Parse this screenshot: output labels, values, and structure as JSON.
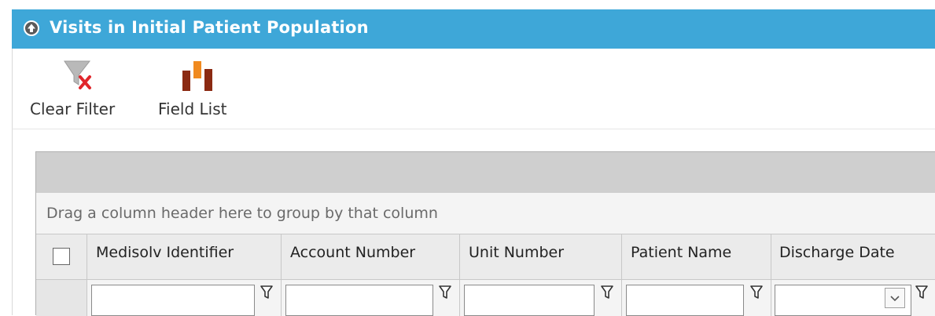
{
  "panel": {
    "title": "Visits in Initial Patient Population",
    "header_color": "#3ea7d8"
  },
  "toolbar": {
    "clear_filter_label": "Clear Filter",
    "field_list_label": "Field List"
  },
  "grid": {
    "group_hint": "Drag a column header here to group by that column",
    "columns": [
      {
        "label": "Medisolv Identifier",
        "filter_value": ""
      },
      {
        "label": "Account Number",
        "filter_value": ""
      },
      {
        "label": "Unit Number",
        "filter_value": ""
      },
      {
        "label": "Patient Name",
        "filter_value": ""
      },
      {
        "label": "Discharge Date",
        "filter_value": ""
      }
    ]
  },
  "icons": {
    "collapse": "collapse-up-circle-icon",
    "clear_filter": "funnel-remove-icon",
    "field_list": "bar-columns-icon",
    "filter": "filter-funnel-icon",
    "dropdown": "chevron-down-icon"
  }
}
